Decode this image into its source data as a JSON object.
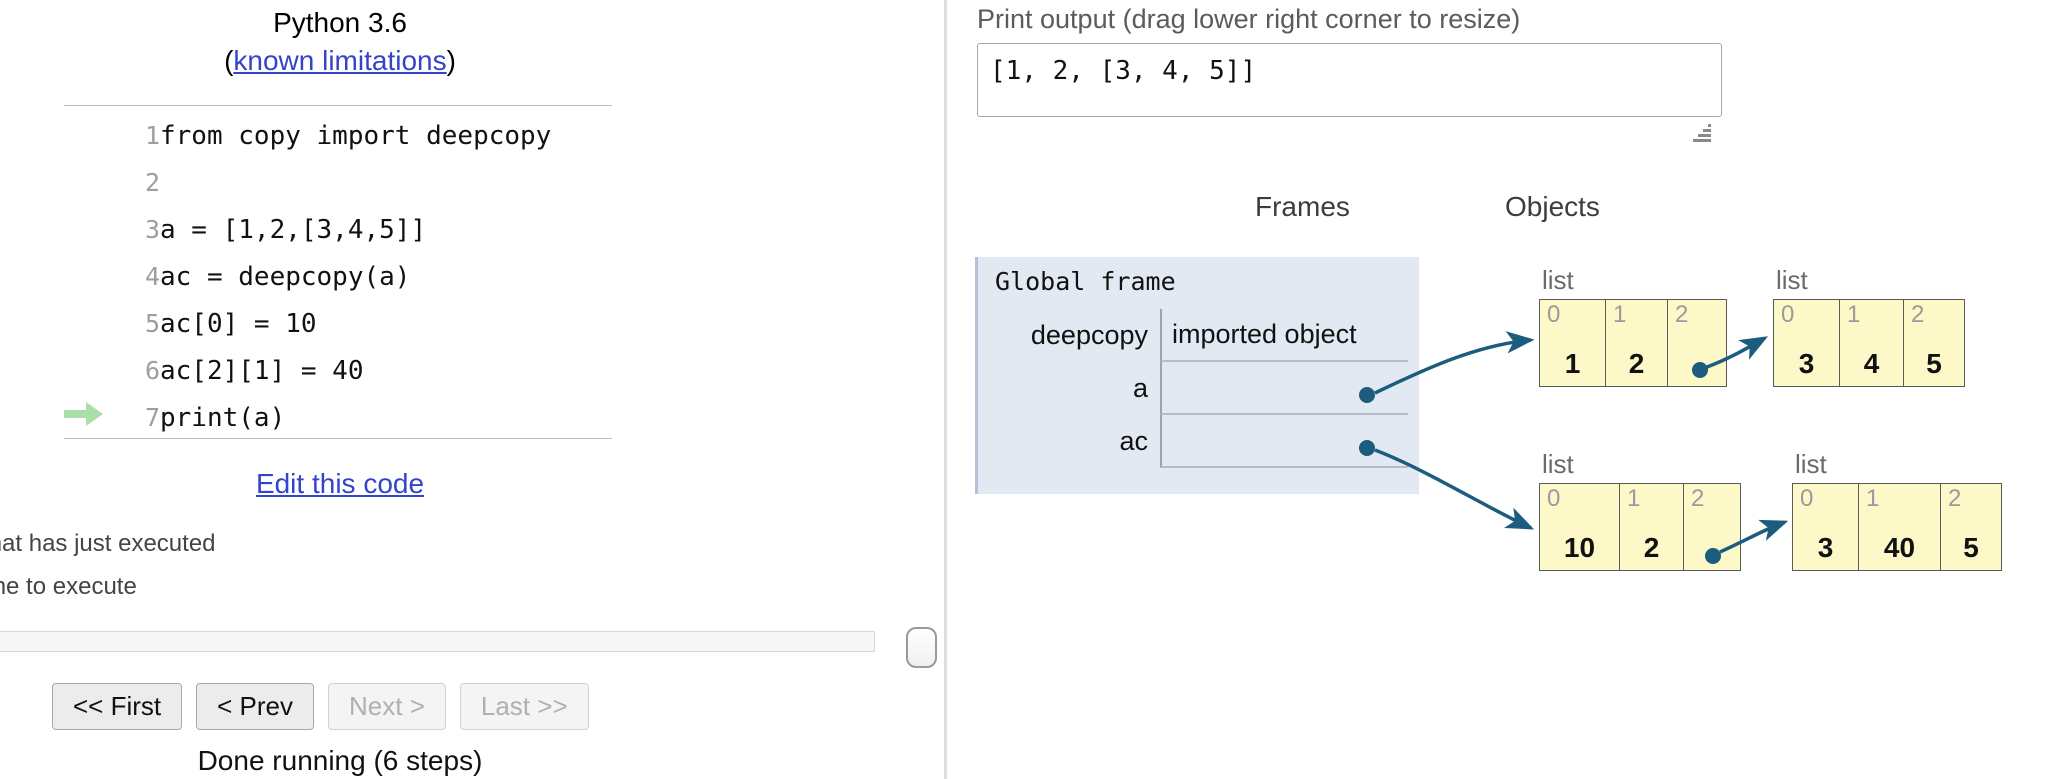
{
  "left": {
    "python_version": "Python 3.6",
    "limitations_prefix": "(",
    "limitations_link": "known limitations",
    "limitations_suffix": ")",
    "code_lines": [
      {
        "number": "1",
        "text": "from copy import deepcopy",
        "current": false
      },
      {
        "number": "2",
        "text": "",
        "current": false
      },
      {
        "number": "3",
        "text": "a = [1,2,[3,4,5]]",
        "current": false
      },
      {
        "number": "4",
        "text": "ac = deepcopy(a)",
        "current": false
      },
      {
        "number": "5",
        "text": "ac[0] = 10",
        "current": false
      },
      {
        "number": "6",
        "text": "ac[2][1] = 40",
        "current": false
      },
      {
        "number": "7",
        "text": "print(a)",
        "current": true
      }
    ],
    "edit_code_link": "Edit this code",
    "legend_executed": "line that has just executed",
    "legend_to_execute": "next line to execute",
    "nav_buttons": [
      {
        "label": "<< First",
        "disabled": false
      },
      {
        "label": "< Prev",
        "disabled": false
      },
      {
        "label": "Next >",
        "disabled": true
      },
      {
        "label": "Last >>",
        "disabled": true
      }
    ],
    "status": "Done running (6 steps)"
  },
  "right": {
    "print_output_label": "Print output (drag lower right corner to resize)",
    "print_output_value": "[1, 2, [3, 4, 5]]",
    "frames_header": "Frames",
    "objects_header": "Objects",
    "global_frame": {
      "title": "Global frame",
      "variables": [
        {
          "name": "deepcopy",
          "value": "imported object"
        },
        {
          "name": "a",
          "value": ""
        },
        {
          "name": "ac",
          "value": ""
        }
      ]
    },
    "objects": [
      {
        "id": "obj-a",
        "type_label": "list",
        "cells": [
          {
            "index": "0",
            "value": "1"
          },
          {
            "index": "1",
            "value": "2"
          },
          {
            "index": "2",
            "value": ""
          }
        ]
      },
      {
        "id": "obj-a-inner",
        "type_label": "list",
        "cells": [
          {
            "index": "0",
            "value": "3"
          },
          {
            "index": "1",
            "value": "4"
          },
          {
            "index": "2",
            "value": "5"
          }
        ]
      },
      {
        "id": "obj-ac",
        "type_label": "list",
        "cells": [
          {
            "index": "0",
            "value": "10"
          },
          {
            "index": "1",
            "value": "2"
          },
          {
            "index": "2",
            "value": ""
          }
        ]
      },
      {
        "id": "obj-ac-inner",
        "type_label": "list",
        "cells": [
          {
            "index": "0",
            "value": "3"
          },
          {
            "index": "1",
            "value": "40"
          },
          {
            "index": "2",
            "value": "5"
          }
        ]
      }
    ]
  },
  "colors": {
    "link": "#3344cc",
    "frame_bg": "#e2e9f3",
    "list_bg": "#fcf8c8",
    "pointer": "#1b5c7f",
    "current_line_arrow": "#a9dfa9"
  }
}
